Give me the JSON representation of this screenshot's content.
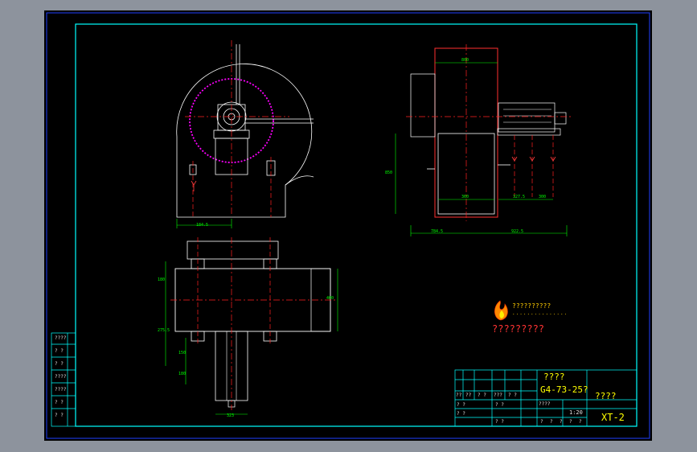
{
  "viewport": {
    "background": "#8d939d",
    "paper": "#000000"
  },
  "colors": {
    "frame": "#00ffff",
    "geometry": "#ffffff",
    "centerline": "#ff2020",
    "dimension": "#00ff00",
    "hidden": "#ff00ff",
    "text": "#ffff00"
  },
  "logo": {
    "icon": "flame-logo-icon",
    "name": "??????????",
    "subtitle": "..............."
  },
  "note": "?????????",
  "dimensions": {
    "front_width": "184.5",
    "side_top": "800",
    "side_height": "850",
    "side_opening": "360",
    "side_gap": "327.5",
    "side_foot": "300",
    "side_left": "784.5",
    "side_right": "922.5",
    "plan_upper": "180",
    "plan_mid": "275.5",
    "plan_depth": "400",
    "plan_low1": "150",
    "plan_low2": "180",
    "plan_bottom": "323"
  },
  "revision_column": [
    "????",
    "? ?",
    "? ?",
    "????",
    "????",
    "? ?",
    "? ?"
  ],
  "title_block": {
    "name_label": "????",
    "model": "G4-73-25?",
    "company": "????",
    "drawing_number": "XT-2",
    "scale": "1:20",
    "ratio_label": "????",
    "header_cells": [
      "??",
      "??",
      "? ?",
      "???",
      "? ?"
    ],
    "row_cells": [
      "? ?",
      "? ?",
      "? ?",
      "? ?"
    ],
    "bottom_cells": [
      "?",
      "?",
      "?",
      "?",
      "?"
    ]
  }
}
